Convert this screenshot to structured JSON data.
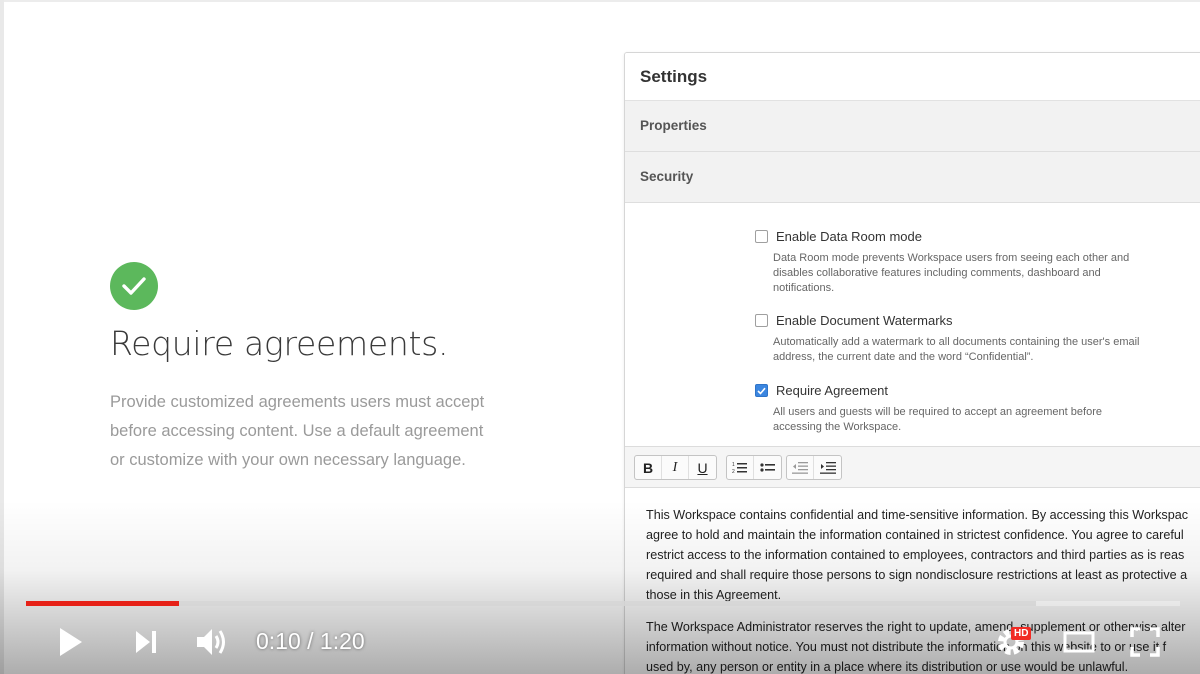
{
  "slide": {
    "headline": "Require agreements.",
    "description": "Provide customized agreements users must accept before accessing content. Use a default agreement or customize with your own necessary language."
  },
  "settings": {
    "title": "Settings",
    "sections": [
      "Properties",
      "Security"
    ],
    "options": [
      {
        "label": "Enable Data Room mode",
        "checked": false,
        "help": "Data Room mode prevents Workspace users from seeing each other and disables collaborative features including comments, dashboard and notifications."
      },
      {
        "label": "Enable Document Watermarks",
        "checked": false,
        "help": "Automatically add a watermark to all documents containing the user's email address, the current date and the word “Confidential”."
      },
      {
        "label": "Require Agreement",
        "checked": true,
        "help": "All users and guests will be required to accept an agreement before accessing the Workspace."
      }
    ],
    "toolbar": {
      "bold": "B",
      "italic": "I",
      "underline": "U"
    },
    "agreement_paragraphs": [
      [
        "This Workspace contains confidential and time-sensitive information. By accessing this Workspac",
        "agree to hold and maintain the information contained in strictest confidence. You agree to careful",
        "restrict access to the information contained to employees, contractors and third parties as is reas",
        "required and shall require those persons to sign nondisclosure restrictions at least as protective a",
        "those in this Agreement."
      ],
      [
        "The Workspace Administrator reserves the right to update, amend, supplement or otherwise alter",
        "information without notice. You must not distribute the information on this website to or use it f",
        "used by, any person or entity in a place where its distribution or use would be unlawful."
      ]
    ]
  },
  "player": {
    "time": "0:10 / 1:20",
    "hd_label": "HD",
    "progress_played": 0.133,
    "progress_buffered": 0.875,
    "colors": {
      "played": "#e62117",
      "check": "#5cb85c",
      "checkbox_on": "#3b86e0"
    }
  }
}
